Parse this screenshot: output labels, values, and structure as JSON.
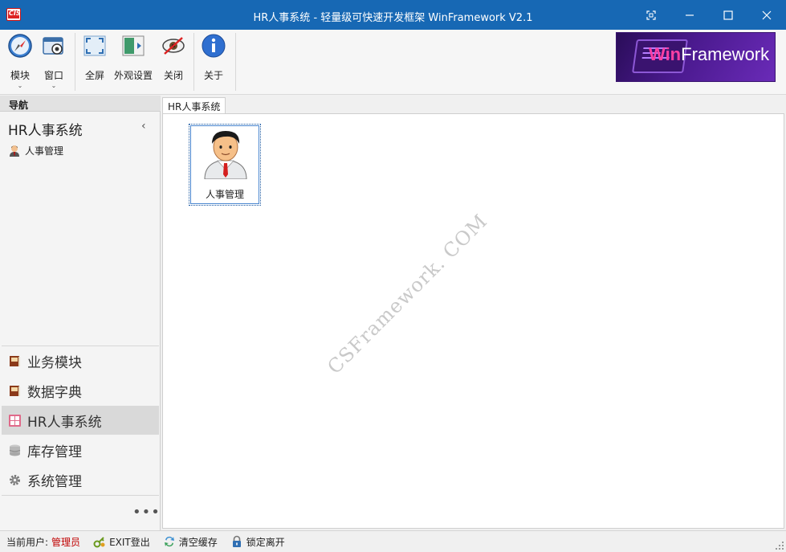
{
  "window": {
    "title": "HR人事系统 - 轻量级可快速开发框架 WinFramework V2.1",
    "app_icon_text": "CIS"
  },
  "toolbar": {
    "module_label": "模块",
    "window_label": "窗口",
    "fullscreen_label": "全屏",
    "appearance_label": "外观设置",
    "close_label": "关闭",
    "about_label": "关于"
  },
  "logo": {
    "win": "Win",
    "framework": "Framework"
  },
  "nav": {
    "header": "导航",
    "group_title": "HR人事系统",
    "subitems": [
      {
        "label": "人事管理",
        "icon": "person-icon"
      }
    ],
    "modules": [
      {
        "label": "业务模块",
        "icon": "book-icon"
      },
      {
        "label": "数据字典",
        "icon": "book-icon"
      },
      {
        "label": "HR人事系统",
        "icon": "calculator-icon"
      },
      {
        "label": "库存管理",
        "icon": "database-icon"
      },
      {
        "label": "系统管理",
        "icon": "gear-icon"
      }
    ],
    "active_module": "HR人事系统",
    "more": "•••"
  },
  "content": {
    "tab_label": "HR人事系统",
    "tiles": [
      {
        "label": "人事管理",
        "icon": "businessman-icon"
      }
    ],
    "watermark": "CSFramework. COM"
  },
  "status": {
    "current_user_label": "当前用户:",
    "current_user": "管理员",
    "exit_label": "EXIT登出",
    "clear_cache_label": "清空缓存",
    "lock_label": "锁定离开"
  },
  "colors": {
    "titlebar": "#1768b4",
    "user_name": "#c00000",
    "logo_accent": "#ff3fa4"
  }
}
